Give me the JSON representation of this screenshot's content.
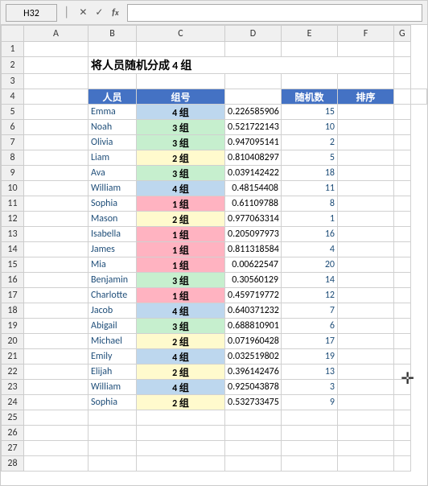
{
  "titlebar": {
    "namebox": "H32",
    "formula": ""
  },
  "header": {
    "title": "将人员随机分成 4 组",
    "cols": [
      "",
      "A",
      "B",
      "C",
      "D",
      "E",
      "F",
      "G"
    ]
  },
  "columnHeaders": [
    "",
    "A",
    "B",
    "C",
    "D",
    "E",
    "F",
    "G"
  ],
  "tableHeaders": [
    "人员",
    "组号",
    "随机数",
    "排序"
  ],
  "rows": [
    {
      "row": "1",
      "name": "",
      "group": "",
      "groupNum": "",
      "random": "",
      "rank": "",
      "extra": ""
    },
    {
      "row": "2",
      "name": "将人员随机分成 4 组",
      "group": "",
      "groupNum": "",
      "random": "",
      "rank": "",
      "extra": ""
    },
    {
      "row": "3",
      "name": "",
      "group": "",
      "groupNum": "",
      "random": "",
      "rank": "",
      "extra": ""
    },
    {
      "row": "4",
      "name": "人员",
      "group": "组号",
      "groupNum": "",
      "random": "随机数",
      "rank": "排序",
      "extra": ""
    },
    {
      "row": "5",
      "name": "Emma",
      "group": "4 组",
      "groupClass": "bg-group4",
      "random": "0.226585906",
      "rank": "15"
    },
    {
      "row": "6",
      "name": "Noah",
      "group": "3 组",
      "groupClass": "bg-group3",
      "random": "0.521722143",
      "rank": "10"
    },
    {
      "row": "7",
      "name": "Olivia",
      "group": "3 组",
      "groupClass": "bg-group3",
      "random": "0.947095141",
      "rank": "2"
    },
    {
      "row": "8",
      "name": "Liam",
      "group": "2 组",
      "groupClass": "bg-group2",
      "random": "0.810408297",
      "rank": "5"
    },
    {
      "row": "9",
      "name": "Ava",
      "group": "3 组",
      "groupClass": "bg-group3",
      "random": "0.039142422",
      "rank": "18"
    },
    {
      "row": "10",
      "name": "William",
      "group": "4 组",
      "groupClass": "bg-group4",
      "random": "0.48154408",
      "rank": "11"
    },
    {
      "row": "11",
      "name": "Sophia",
      "group": "1 组",
      "groupClass": "bg-group1",
      "random": "0.61109788",
      "rank": "8"
    },
    {
      "row": "12",
      "name": "Mason",
      "group": "2 组",
      "groupClass": "bg-group2",
      "random": "0.977063314",
      "rank": "1"
    },
    {
      "row": "13",
      "name": "Isabella",
      "group": "1 组",
      "groupClass": "bg-group1",
      "random": "0.205097973",
      "rank": "16"
    },
    {
      "row": "14",
      "name": "James",
      "group": "1 组",
      "groupClass": "bg-group1",
      "random": "0.811318584",
      "rank": "4"
    },
    {
      "row": "15",
      "name": "Mia",
      "group": "1 组",
      "groupClass": "bg-group1",
      "random": "0.00622547",
      "rank": "20"
    },
    {
      "row": "16",
      "name": "Benjamin",
      "group": "3 组",
      "groupClass": "bg-group3",
      "random": "0.30560129",
      "rank": "14"
    },
    {
      "row": "17",
      "name": "Charlotte",
      "group": "1 组",
      "groupClass": "bg-group1",
      "random": "0.459719772",
      "rank": "12"
    },
    {
      "row": "18",
      "name": "Jacob",
      "group": "4 组",
      "groupClass": "bg-group4",
      "random": "0.640371232",
      "rank": "7"
    },
    {
      "row": "19",
      "name": "Abigail",
      "group": "3 组",
      "groupClass": "bg-group3",
      "random": "0.688810901",
      "rank": "6"
    },
    {
      "row": "20",
      "name": "Michael",
      "group": "2 组",
      "groupClass": "bg-group2",
      "random": "0.071960428",
      "rank": "17"
    },
    {
      "row": "21",
      "name": "Emily",
      "group": "4 组",
      "groupClass": "bg-group4",
      "random": "0.032519802",
      "rank": "19"
    },
    {
      "row": "22",
      "name": "Elijah",
      "group": "2 组",
      "groupClass": "bg-group2",
      "random": "0.396142476",
      "rank": "13"
    },
    {
      "row": "23",
      "name": "William",
      "group": "4 组",
      "groupClass": "bg-group4",
      "random": "0.925043878",
      "rank": "3"
    },
    {
      "row": "24",
      "name": "Sophia",
      "group": "2 组",
      "groupClass": "bg-group2",
      "random": "0.532733475",
      "rank": "9"
    },
    {
      "row": "25",
      "name": "",
      "group": "",
      "groupClass": "",
      "random": "",
      "rank": ""
    },
    {
      "row": "26",
      "name": "",
      "group": "",
      "groupClass": "",
      "random": "",
      "rank": ""
    },
    {
      "row": "27",
      "name": "",
      "group": "",
      "groupClass": "",
      "random": "",
      "rank": ""
    },
    {
      "row": "28",
      "name": "",
      "group": "",
      "groupClass": "",
      "random": "",
      "rank": ""
    }
  ]
}
